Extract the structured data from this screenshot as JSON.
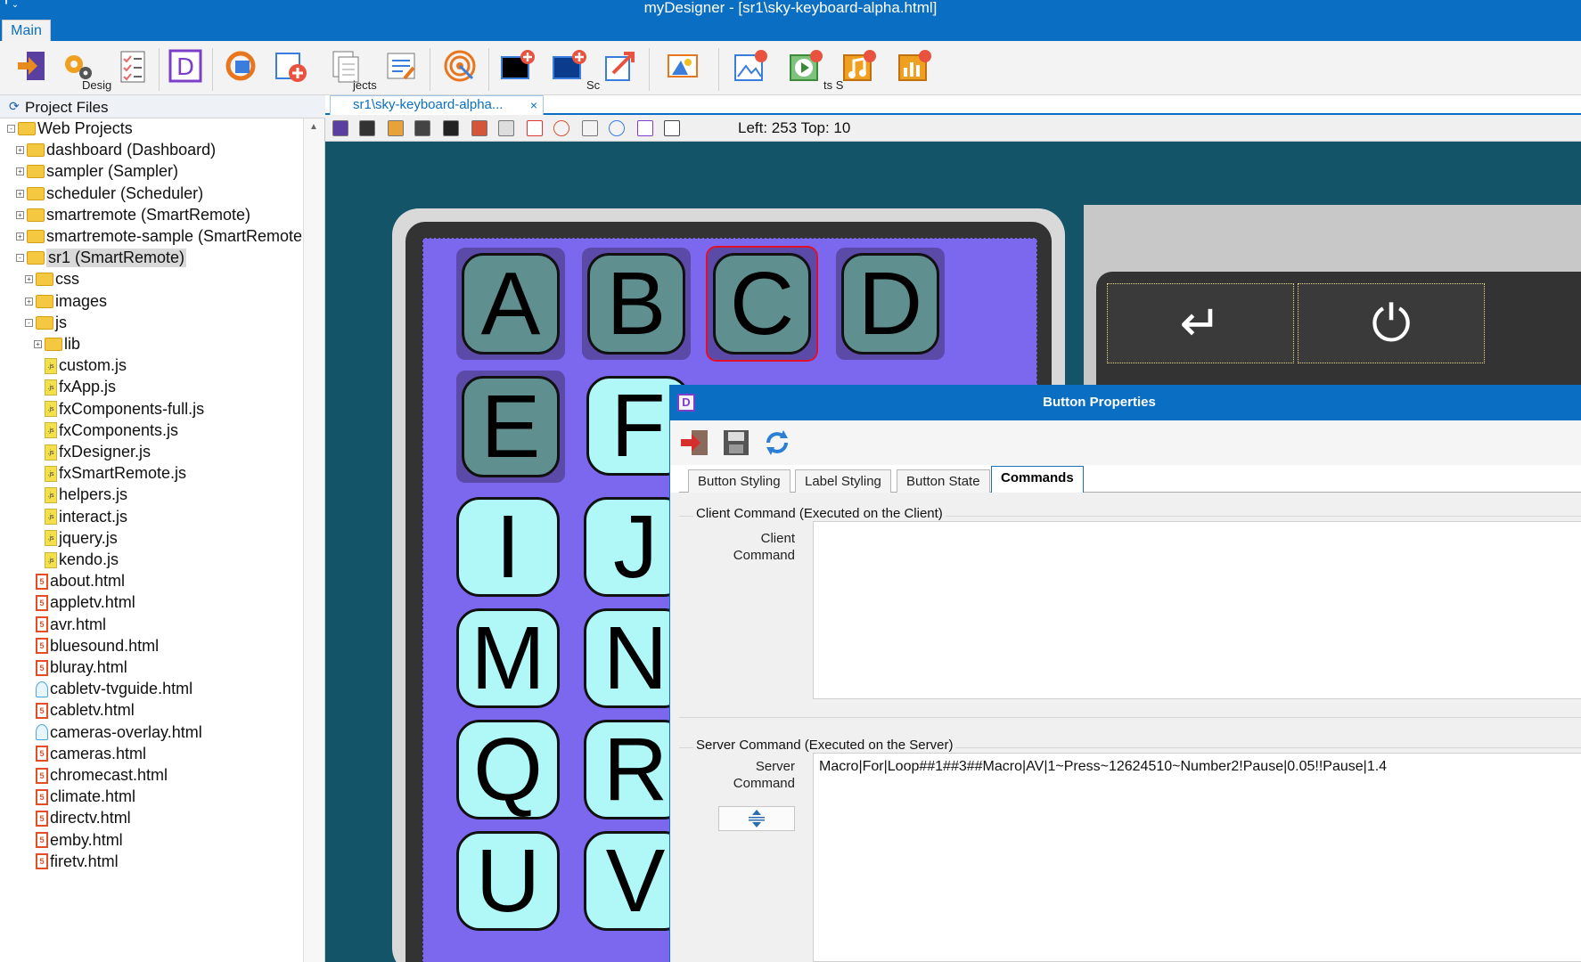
{
  "window": {
    "title": "myDesigner - [sr1\\sky-keyboard-alpha.html]",
    "main_tab": "Main"
  },
  "ribbon": {
    "captions": [
      "Desig",
      "jects",
      "Sc",
      "ts S"
    ]
  },
  "project_panel": {
    "title": "Project Files",
    "tree": [
      {
        "label": "Web Projects",
        "type": "folder",
        "depth": 0,
        "toggle": "-"
      },
      {
        "label": "dashboard  (Dashboard)",
        "type": "folder",
        "depth": 1,
        "toggle": "+"
      },
      {
        "label": "sampler  (Sampler)",
        "type": "folder",
        "depth": 1,
        "toggle": "+"
      },
      {
        "label": "scheduler  (Scheduler)",
        "type": "folder",
        "depth": 1,
        "toggle": "+"
      },
      {
        "label": "smartremote  (SmartRemote)",
        "type": "folder",
        "depth": 1,
        "toggle": "+"
      },
      {
        "label": "smartremote-sample  (SmartRemote",
        "type": "folder",
        "depth": 1,
        "toggle": "+"
      },
      {
        "label": "sr1  (SmartRemote)",
        "type": "folder",
        "depth": 1,
        "toggle": "-",
        "selected": true
      },
      {
        "label": "css",
        "type": "folder",
        "depth": 2,
        "toggle": "+"
      },
      {
        "label": "images",
        "type": "folder",
        "depth": 2,
        "toggle": "+"
      },
      {
        "label": "js",
        "type": "folder",
        "depth": 2,
        "toggle": "-"
      },
      {
        "label": "lib",
        "type": "folder",
        "depth": 3,
        "toggle": "+"
      },
      {
        "label": "custom.js",
        "type": "js",
        "depth": 3
      },
      {
        "label": "fxApp.js",
        "type": "js",
        "depth": 3
      },
      {
        "label": "fxComponents-full.js",
        "type": "js",
        "depth": 3
      },
      {
        "label": "fxComponents.js",
        "type": "js",
        "depth": 3
      },
      {
        "label": "fxDesigner.js",
        "type": "js",
        "depth": 3
      },
      {
        "label": "fxSmartRemote.js",
        "type": "js",
        "depth": 3
      },
      {
        "label": "helpers.js",
        "type": "js",
        "depth": 3
      },
      {
        "label": "interact.js",
        "type": "js",
        "depth": 3
      },
      {
        "label": "jquery.js",
        "type": "js",
        "depth": 3
      },
      {
        "label": "kendo.js",
        "type": "js",
        "depth": 3
      },
      {
        "label": "about.html",
        "type": "html",
        "depth": 2
      },
      {
        "label": "appletv.html",
        "type": "html",
        "depth": 2
      },
      {
        "label": "avr.html",
        "type": "html",
        "depth": 2
      },
      {
        "label": "bluesound.html",
        "type": "html",
        "depth": 2
      },
      {
        "label": "bluray.html",
        "type": "html",
        "depth": 2
      },
      {
        "label": "cabletv-tvguide.html",
        "type": "globe",
        "depth": 2
      },
      {
        "label": "cabletv.html",
        "type": "html",
        "depth": 2
      },
      {
        "label": "cameras-overlay.html",
        "type": "globe",
        "depth": 2
      },
      {
        "label": "cameras.html",
        "type": "html",
        "depth": 2
      },
      {
        "label": "chromecast.html",
        "type": "html",
        "depth": 2
      },
      {
        "label": "climate.html",
        "type": "html",
        "depth": 2
      },
      {
        "label": "directv.html",
        "type": "html",
        "depth": 2
      },
      {
        "label": "emby.html",
        "type": "html",
        "depth": 2
      },
      {
        "label": "firetv.html",
        "type": "html",
        "depth": 2
      }
    ]
  },
  "document": {
    "tab_label": "sr1\\sky-keyboard-alpha...",
    "tab_close": "×",
    "position_readout": "Left: 253 Top: 10"
  },
  "keyboard": {
    "keys": [
      {
        "label": "A",
        "style": "dark"
      },
      {
        "label": "B",
        "style": "dark"
      },
      {
        "label": "C",
        "style": "dark",
        "selected": true
      },
      {
        "label": "D",
        "style": "dark"
      },
      {
        "label": "E",
        "style": "dark"
      },
      {
        "label": "F",
        "style": "light"
      },
      {
        "label": "I",
        "style": "light"
      },
      {
        "label": "J",
        "style": "light"
      },
      {
        "label": "M",
        "style": "light"
      },
      {
        "label": "N",
        "style": "light"
      },
      {
        "label": "Q",
        "style": "light"
      },
      {
        "label": "R",
        "style": "light"
      },
      {
        "label": "U",
        "style": "light"
      },
      {
        "label": "V",
        "style": "light"
      }
    ],
    "panel_keys": [
      "↵",
      "⏻"
    ]
  },
  "dialog": {
    "title": "Button Properties",
    "app_icon": "D",
    "tabs": [
      "Button Styling",
      "Label Styling",
      "Button State",
      "Commands"
    ],
    "active_tab": "Commands",
    "client_group": "Client Command (Executed on the Client)",
    "client_label_line1": "Client",
    "client_label_line2": "Command",
    "client_value": "",
    "server_group": "Server Command (Executed on the Server)",
    "server_label_line1": "Server",
    "server_label_line2": "Command",
    "server_value": "Macro|For|Loop##1##3##Macro|AV|1~Press~12624510~Number2!Pause|0.05!!Pause|1.4"
  }
}
